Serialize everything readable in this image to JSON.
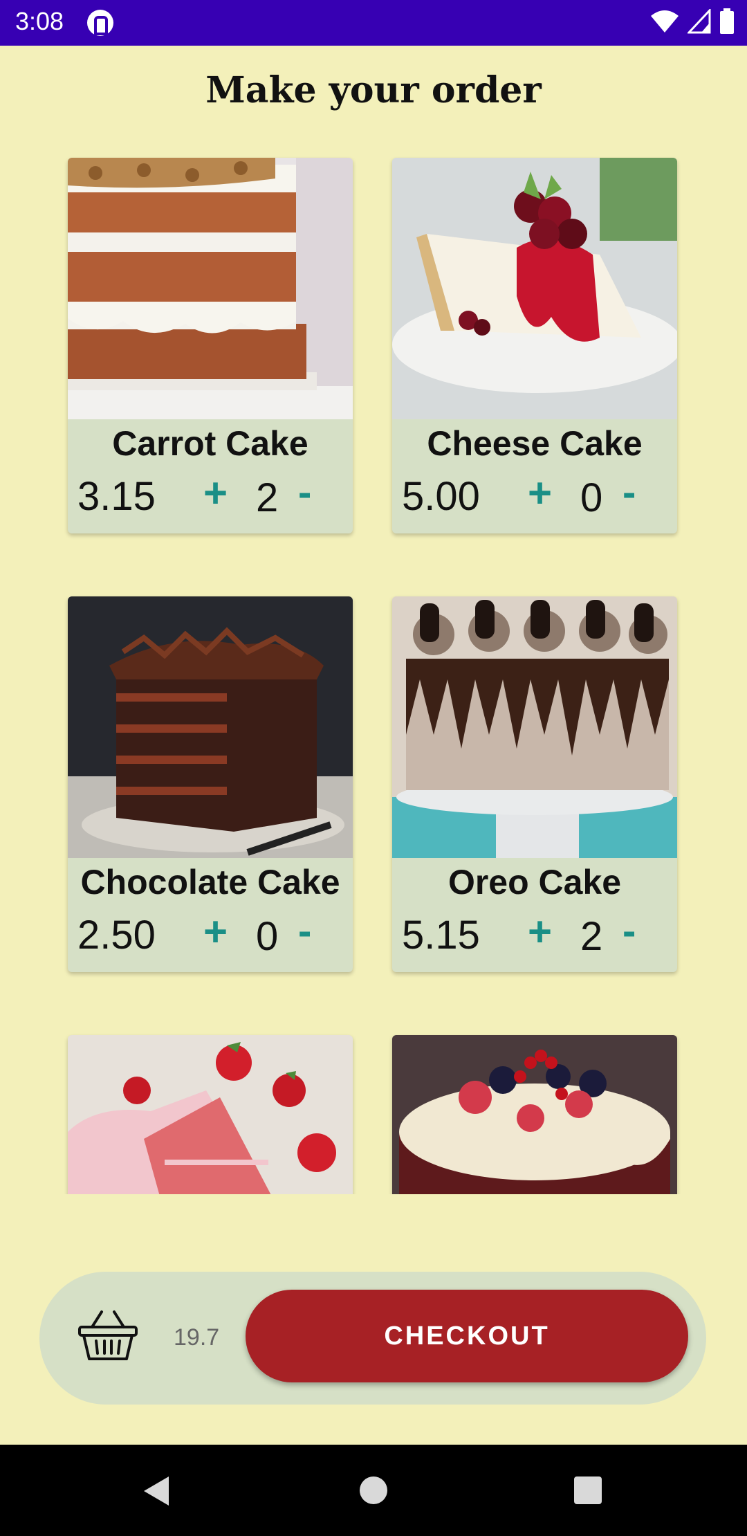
{
  "status_bar": {
    "time": "3:08"
  },
  "title": "Make your order",
  "products": [
    {
      "name": "Carrot Cake",
      "price": "3.15",
      "plus": "+",
      "quantity": "2",
      "minus": "-"
    },
    {
      "name": "Cheese Cake",
      "price": "5.00",
      "plus": "+",
      "quantity": "0",
      "minus": "-"
    },
    {
      "name": "Chocolate Cake",
      "price": "2.50",
      "plus": "+",
      "quantity": "0",
      "minus": "-"
    },
    {
      "name": "Oreo Cake",
      "price": "5.15",
      "plus": "+",
      "quantity": "2",
      "minus": "-"
    }
  ],
  "bottom_bar": {
    "total": "19.7",
    "checkout_label": "CHECKOUT"
  },
  "colors": {
    "background": "#f3f0ba",
    "card": "#d6e0c6",
    "accent": "#1a8f86",
    "checkout": "#a72125",
    "status_bar": "#3700b3"
  }
}
